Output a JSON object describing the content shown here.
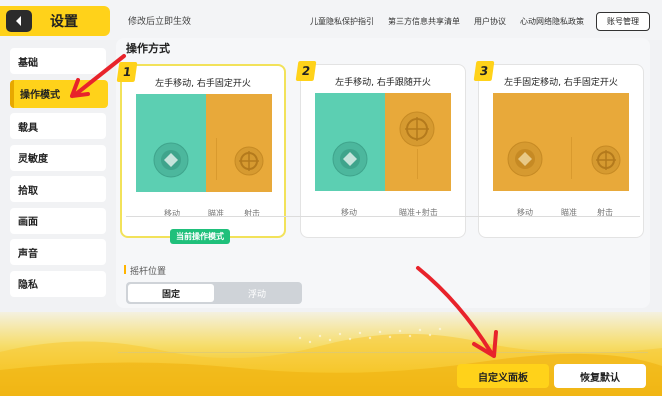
{
  "header": {
    "title": "设置",
    "hint": "修改后立即生效",
    "links": [
      "儿童隐私保护指引",
      "第三方信息共享清单",
      "用户协议",
      "心动网络隐私政策"
    ],
    "account_button": "账号管理"
  },
  "sidebar": {
    "items": [
      {
        "label": "基础",
        "active": false
      },
      {
        "label": "操作模式",
        "active": true
      },
      {
        "label": "载具",
        "active": false
      },
      {
        "label": "灵敏度",
        "active": false
      },
      {
        "label": "拾取",
        "active": false
      },
      {
        "label": "画面",
        "active": false
      },
      {
        "label": "声音",
        "active": false
      },
      {
        "label": "隐私",
        "active": false
      }
    ]
  },
  "main": {
    "section_title": "操作方式",
    "cards": [
      {
        "number": "1",
        "title": "左手移动, 右手固定开火",
        "labels": [
          "移动",
          "瞄准",
          "射击"
        ],
        "selected": true
      },
      {
        "number": "2",
        "title": "左手移动, 右手跟随开火",
        "labels": [
          "移动",
          "瞄准+射击"
        ],
        "selected": false
      },
      {
        "number": "3",
        "title": "左手固定移动, 右手固定开火",
        "labels": [
          "移动",
          "瞄准",
          "射击"
        ],
        "selected": false
      }
    ],
    "current_badge": "当前操作模式",
    "joystick_title": "摇杆位置",
    "joystick_options": [
      "固定",
      "浮动"
    ],
    "joystick_selected": "固定"
  },
  "footer": {
    "custom_panel_button": "自定义面板",
    "reset_button": "恢复默认"
  },
  "colors": {
    "accent": "#ffd21a",
    "teal": "#5ccfb2",
    "orange": "#e8a93a",
    "badge_green": "#1fc07b",
    "annotation_red": "#e8232b"
  }
}
